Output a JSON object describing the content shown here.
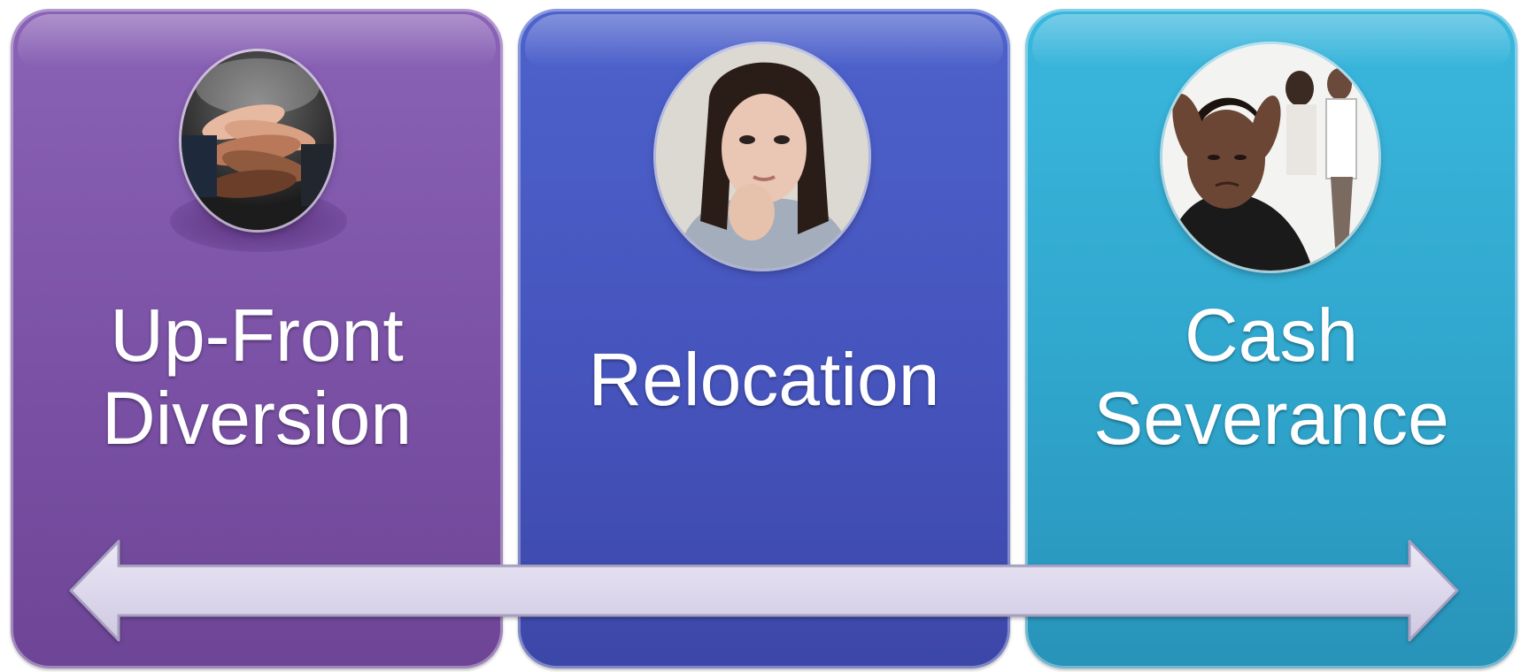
{
  "panels": [
    {
      "lines": [
        "Up-Front",
        "Diversion"
      ],
      "color": "#7a51a5",
      "icon": "stacked-hands-photo"
    },
    {
      "lines": [
        "Relocation"
      ],
      "color": "#4654bd",
      "icon": "worried-woman-photo"
    },
    {
      "lines": [
        "Cash",
        "Severance"
      ],
      "color": "#30a6cd",
      "icon": "distressed-woman-photo"
    }
  ],
  "arrow": {
    "color": "#dcd7ec",
    "direction": "both"
  }
}
